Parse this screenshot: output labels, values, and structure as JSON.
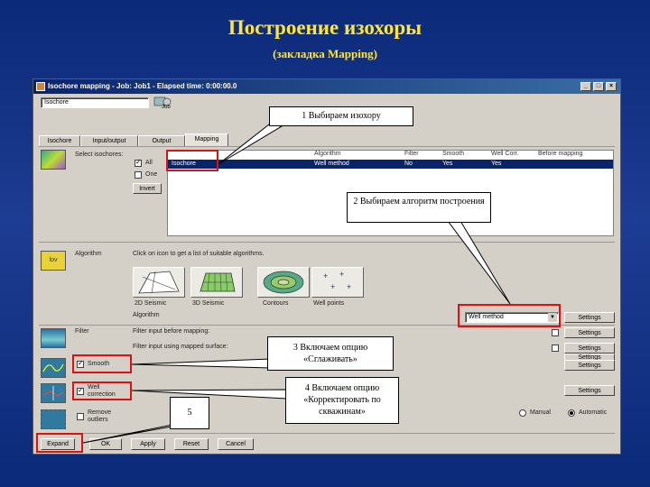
{
  "slide": {
    "title": "Построение изохоры",
    "subtitle": "(закладка Mapping)"
  },
  "window": {
    "title": "Isochore mapping - Job: Job1 - Elapsed time: 0:00:00.0",
    "job_name": "Isochore",
    "job_icon_label": "Job"
  },
  "tabs": [
    {
      "label": "Isochore"
    },
    {
      "label": "Input/output"
    },
    {
      "label": "Output"
    },
    {
      "label": "Mapping"
    }
  ],
  "select_isochores": {
    "label": "Select isochores:",
    "all_label": "All",
    "one_label": "One",
    "invert_label": "Invert"
  },
  "table": {
    "headers": [
      "Algorithm",
      "Filter",
      "Smooth",
      "Well Corr.",
      "Before mapping"
    ],
    "row": {
      "name": "Isochore",
      "algorithm": "Well method",
      "filter": "No",
      "smooth": "Yes",
      "wellcorr": "Yes"
    }
  },
  "algorithm": {
    "label": "Algorithm",
    "hint": "Click on icon to get a list of suitable algorithms.",
    "cards": [
      "2D Seismic",
      "3D Seismic",
      "Contours",
      "Well points"
    ],
    "section_label": "Algorithm",
    "selected": "Well method",
    "settings_label": "Settings"
  },
  "filter": {
    "label": "Filter",
    "before": "Filter input before mapping:",
    "using": "Filter input using mapped surface:",
    "settings1": "Settings",
    "settings2": "Settings",
    "settings3": "Settings"
  },
  "smooth": {
    "label": "Smooth",
    "settings": "Settings"
  },
  "wellcorr": {
    "label": "Well correction",
    "settings": "Settings"
  },
  "remove": {
    "label": "Remove outliers",
    "radio1": "Manual",
    "radio2": "Automatic"
  },
  "bottom_buttons": [
    "Expand",
    "OK",
    "Apply",
    "Reset",
    "Cancel"
  ],
  "callouts": {
    "c1": "1 Выбираем изохору",
    "c2": "2 Выбираем алгоритм построения",
    "c3": "3 Включаем опцию «Сглаживать»",
    "c4": "4 Включаем опцию «Корректировать по скважинам»",
    "c5": "5"
  },
  "colors": {
    "accent_red": "#e01010",
    "title_yellow": "#ffe43c",
    "selection_blue": "#0a246a"
  }
}
